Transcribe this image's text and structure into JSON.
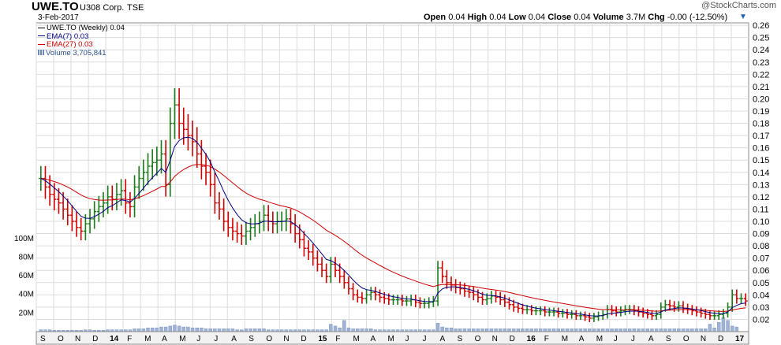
{
  "header": {
    "symbol": "UWE.TO",
    "company": "U308 Corp.",
    "exchange": "TSE",
    "date": "3-Feb-2017",
    "brand": "@StockCharts.com",
    "open_label": "Open",
    "open_value": "0.04",
    "high_label": "High",
    "high_value": "0.04",
    "low_label": "Low",
    "low_value": "0.04",
    "close_label": "Close",
    "close_value": "0.04",
    "volume_label": "Volume",
    "volume_value": "3.7M",
    "chg_label": "Chg",
    "chg_value": "-0.00 (-12.50%)"
  },
  "legend": {
    "price": "UWE.TO (Weekly) 0.04",
    "ema7": "EMA(7) 0.03",
    "ema27": "EMA(27) 0.03",
    "volume": "Volume 3,705,841"
  },
  "colors": {
    "up": "#1a7a1a",
    "down": "#cc0000",
    "ema7": "#000080",
    "ema27": "#cc0000",
    "volume": "#9fb3d6",
    "grid": "#dcdcdc",
    "plot_bg": "#ffffff"
  },
  "icons": {
    "dropdown": "triangle-down-icon",
    "volume_legend": "bar-chart-icon"
  },
  "chart_data": {
    "type": "ohlc",
    "title": "UWE.TO",
    "y_price_ticks": [
      "0.26",
      "0.25",
      "0.24",
      "0.23",
      "0.22",
      "0.21",
      "0.20",
      "0.19",
      "0.18",
      "0.17",
      "0.16",
      "0.15",
      "0.14",
      "0.13",
      "0.12",
      "0.11",
      "0.10",
      "0.09",
      "0.08",
      "0.07",
      "0.06",
      "0.05",
      "0.04",
      "0.03",
      "0.02"
    ],
    "y_price_range": [
      0.01,
      0.262
    ],
    "y_volume_ticks": [
      "100M",
      "80M",
      "60M",
      "40M",
      "20M"
    ],
    "y_volume_range": [
      0,
      110
    ],
    "month_labels": [
      {
        "label": "S",
        "bold": false
      },
      {
        "label": "O",
        "bold": false
      },
      {
        "label": "N",
        "bold": false
      },
      {
        "label": "D",
        "bold": false
      },
      {
        "label": "14",
        "bold": true
      },
      {
        "label": "F",
        "bold": false
      },
      {
        "label": "M",
        "bold": false
      },
      {
        "label": "A",
        "bold": false
      },
      {
        "label": "M",
        "bold": false
      },
      {
        "label": "J",
        "bold": false
      },
      {
        "label": "J",
        "bold": false
      },
      {
        "label": "A",
        "bold": false
      },
      {
        "label": "S",
        "bold": false
      },
      {
        "label": "O",
        "bold": false
      },
      {
        "label": "N",
        "bold": false
      },
      {
        "label": "D",
        "bold": false
      },
      {
        "label": "15",
        "bold": true
      },
      {
        "label": "F",
        "bold": false
      },
      {
        "label": "M",
        "bold": false
      },
      {
        "label": "A",
        "bold": false
      },
      {
        "label": "M",
        "bold": false
      },
      {
        "label": "J",
        "bold": false
      },
      {
        "label": "J",
        "bold": false
      },
      {
        "label": "A",
        "bold": false
      },
      {
        "label": "S",
        "bold": false
      },
      {
        "label": "O",
        "bold": false
      },
      {
        "label": "N",
        "bold": false
      },
      {
        "label": "D",
        "bold": false
      },
      {
        "label": "16",
        "bold": true
      },
      {
        "label": "F",
        "bold": false
      },
      {
        "label": "M",
        "bold": false
      },
      {
        "label": "A",
        "bold": false
      },
      {
        "label": "M",
        "bold": false
      },
      {
        "label": "J",
        "bold": false
      },
      {
        "label": "J",
        "bold": false
      },
      {
        "label": "A",
        "bold": false
      },
      {
        "label": "S",
        "bold": false
      },
      {
        "label": "O",
        "bold": false
      },
      {
        "label": "N",
        "bold": false
      },
      {
        "label": "D",
        "bold": false
      },
      {
        "label": "17",
        "bold": true
      }
    ],
    "close": [
      0.135,
      0.128,
      0.122,
      0.118,
      0.115,
      0.11,
      0.105,
      0.1,
      0.095,
      0.092,
      0.098,
      0.102,
      0.108,
      0.112,
      0.115,
      0.12,
      0.118,
      0.122,
      0.125,
      0.115,
      0.112,
      0.128,
      0.135,
      0.14,
      0.145,
      0.148,
      0.15,
      0.155,
      0.13,
      0.18,
      0.195,
      0.18,
      0.175,
      0.17,
      0.165,
      0.155,
      0.145,
      0.14,
      0.13,
      0.115,
      0.11,
      0.1,
      0.095,
      0.092,
      0.09,
      0.088,
      0.092,
      0.095,
      0.098,
      0.1,
      0.105,
      0.1,
      0.098,
      0.1,
      0.1,
      0.102,
      0.098,
      0.09,
      0.085,
      0.078,
      0.075,
      0.07,
      0.065,
      0.06,
      0.055,
      0.065,
      0.06,
      0.055,
      0.05,
      0.045,
      0.04,
      0.038,
      0.037,
      0.04,
      0.042,
      0.04,
      0.038,
      0.037,
      0.036,
      0.036,
      0.036,
      0.035,
      0.035,
      0.036,
      0.034,
      0.033,
      0.033,
      0.034,
      0.035,
      0.062,
      0.055,
      0.05,
      0.048,
      0.046,
      0.045,
      0.043,
      0.042,
      0.04,
      0.038,
      0.036,
      0.037,
      0.039,
      0.038,
      0.036,
      0.034,
      0.032,
      0.03,
      0.029,
      0.028,
      0.028,
      0.027,
      0.027,
      0.027,
      0.026,
      0.026,
      0.026,
      0.025,
      0.025,
      0.024,
      0.024,
      0.023,
      0.023,
      0.022,
      0.021,
      0.022,
      0.023,
      0.024,
      0.028,
      0.027,
      0.026,
      0.027,
      0.028,
      0.028,
      0.027,
      0.026,
      0.025,
      0.024,
      0.023,
      0.024,
      0.03,
      0.032,
      0.031,
      0.03,
      0.031,
      0.029,
      0.028,
      0.027,
      0.026,
      0.025,
      0.024,
      0.023,
      0.023,
      0.024,
      0.025,
      0.03,
      0.04,
      0.037,
      0.037,
      0.035
    ],
    "volume": [
      2,
      2,
      2,
      1.5,
      1.5,
      1.5,
      1.5,
      1.5,
      1.5,
      1.5,
      2,
      2,
      1.5,
      1.5,
      1.5,
      2,
      2,
      2,
      2,
      2,
      2,
      3,
      3,
      3,
      4,
      4,
      4,
      5,
      5,
      6,
      7,
      6,
      5,
      5,
      4,
      4,
      4,
      3,
      3,
      3,
      3,
      3,
      3,
      3,
      2,
      2,
      3,
      3,
      3,
      3,
      3,
      2,
      2,
      2,
      2,
      2,
      2,
      2,
      2,
      2,
      2,
      2,
      2,
      2,
      2,
      8,
      6,
      4,
      12,
      4,
      3,
      3,
      3,
      3,
      3,
      2,
      2,
      2,
      2,
      2,
      2,
      2,
      2,
      2,
      2,
      2,
      2,
      2,
      2,
      9,
      5,
      4,
      4,
      3,
      3,
      3,
      3,
      3,
      3,
      3,
      3,
      3,
      3,
      3,
      3,
      3,
      3,
      3,
      3,
      3,
      3,
      3,
      3,
      3,
      3,
      3,
      3,
      3,
      3,
      3,
      3,
      3,
      3,
      3,
      3,
      3,
      3,
      3,
      3,
      3,
      3,
      3,
      3,
      3,
      3,
      3,
      3,
      3,
      3,
      3,
      3,
      3,
      3,
      3,
      3,
      3,
      3,
      3,
      3,
      3,
      8,
      4,
      10,
      15,
      12,
      6,
      5
    ]
  }
}
